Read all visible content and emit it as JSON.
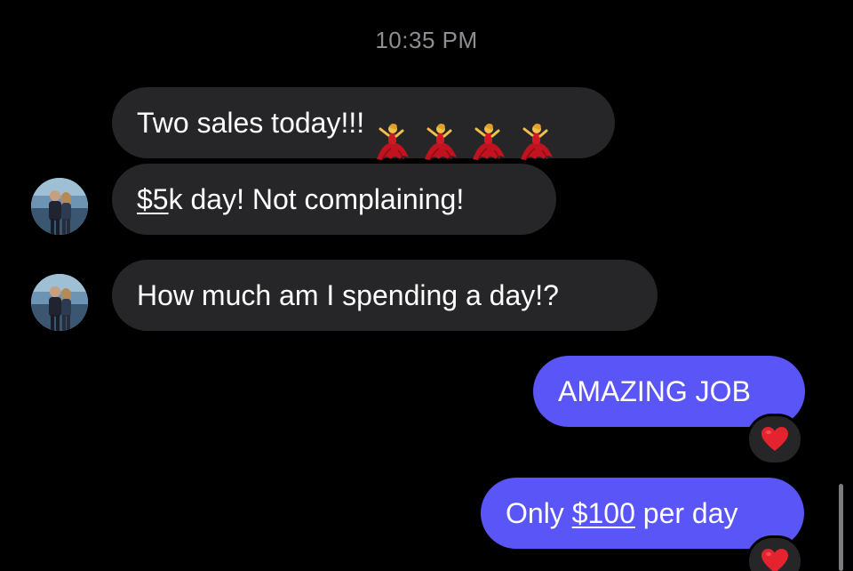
{
  "conversation": {
    "timestamp": "10:35 PM",
    "messages": [
      {
        "sender": "other",
        "parts": {
          "text": "Two sales today!!!"
        },
        "emoji": "dancer-emoji",
        "emoji_count": 4
      },
      {
        "sender": "other",
        "parts": {
          "underlined": "$5",
          "text": "k day! Not complaining!"
        }
      },
      {
        "sender": "other",
        "parts": {
          "text": "How much am I spending a day!?"
        }
      },
      {
        "sender": "me",
        "parts": {
          "text": "AMAZING JOB"
        },
        "reaction": "heart-reaction-icon"
      },
      {
        "sender": "me",
        "parts": {
          "before": "Only ",
          "underlined": "$100",
          "after": " per day"
        },
        "reaction": "heart-reaction-icon"
      }
    ]
  },
  "colors": {
    "background": "#000000",
    "incoming_bubble": "#262628",
    "outgoing_bubble": "#5a55f6",
    "timestamp": "#8e8e93",
    "heart": "#e5232f"
  }
}
